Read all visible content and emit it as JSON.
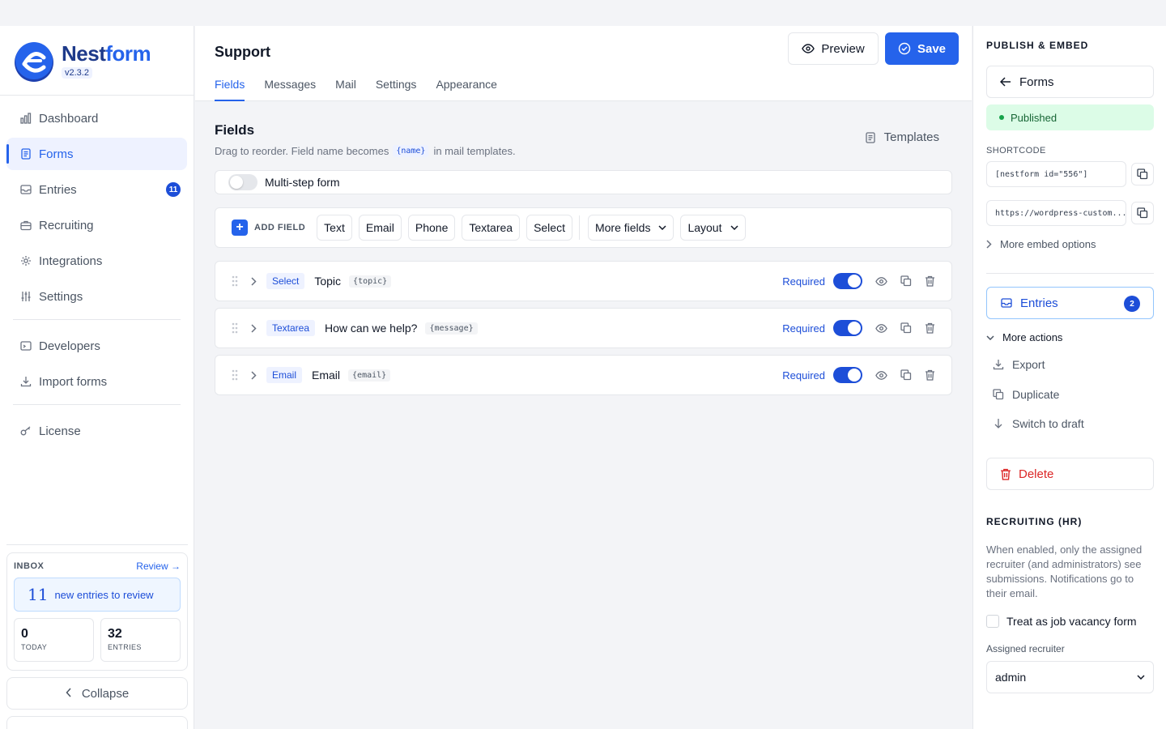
{
  "brand": {
    "name_part1": "Nest",
    "name_part2": "form",
    "version": "v2.3.2"
  },
  "nav": {
    "items": [
      {
        "label": "Dashboard",
        "icon": "bar-chart-icon"
      },
      {
        "label": "Forms",
        "icon": "form-icon",
        "active": true
      },
      {
        "label": "Entries",
        "icon": "inbox-icon",
        "badge": "11"
      },
      {
        "label": "Recruiting",
        "icon": "briefcase-icon"
      },
      {
        "label": "Integrations",
        "icon": "integrations-icon"
      },
      {
        "label": "Settings",
        "icon": "sliders-icon"
      }
    ],
    "secondary": [
      {
        "label": "Developers",
        "icon": "terminal-icon"
      },
      {
        "label": "Import forms",
        "icon": "download-icon"
      }
    ],
    "tertiary": [
      {
        "label": "License",
        "icon": "key-icon"
      }
    ]
  },
  "inbox": {
    "title": "INBOX",
    "review_label": "Review",
    "new_count": "11",
    "new_text": "new entries to review",
    "today_value": "0",
    "today_label": "TODAY",
    "entries_value": "32",
    "entries_label": "ENTRIES"
  },
  "collapse_label": "Collapse",
  "header": {
    "title": "Support",
    "preview_label": "Preview",
    "save_label": "Save",
    "tabs": [
      "Fields",
      "Messages",
      "Mail",
      "Settings",
      "Appearance"
    ]
  },
  "fields_section": {
    "title": "Fields",
    "sub_before": "Drag to reorder. Field name becomes",
    "sub_code": "{name}",
    "sub_after": "in mail templates.",
    "templates_label": "Templates",
    "multistep_label": "Multi-step form"
  },
  "add_field": {
    "label": "ADD FIELD",
    "chips": [
      "Text",
      "Email",
      "Phone",
      "Textarea",
      "Select"
    ],
    "more_fields": "More fields",
    "layout": "Layout"
  },
  "fields": [
    {
      "type": "Select",
      "name": "Topic",
      "key": "{topic}",
      "required_label": "Required",
      "required": true
    },
    {
      "type": "Textarea",
      "name": "How can we help?",
      "key": "{message}",
      "required_label": "Required",
      "required": true
    },
    {
      "type": "Email",
      "name": "Email",
      "key": "{email}",
      "required_label": "Required",
      "required": true
    }
  ],
  "right_panel": {
    "publish_title": "PUBLISH & EMBED",
    "forms_label": "Forms",
    "status": "Published",
    "shortcode_label": "SHORTCODE",
    "shortcode": "[nestform id=\"556\"]",
    "embed_url": "https://wordpress-custom...",
    "more_embed": "More embed options",
    "entries_label": "Entries",
    "entries_count": "2",
    "more_actions": "More actions",
    "actions": [
      "Export",
      "Duplicate",
      "Switch to draft"
    ],
    "delete_label": "Delete",
    "recruiting_title": "RECRUITING (HR)",
    "recruiting_desc": "When enabled, only the assigned recruiter (and administrators) see submissions. Notifications go to their email.",
    "vacancy_label": "Treat as job vacancy form",
    "assigned_label": "Assigned recruiter",
    "assigned_value": "admin"
  },
  "colors": {
    "accent": "#2563eb",
    "published_bg": "#dcfce7",
    "danger": "#dc2626"
  }
}
